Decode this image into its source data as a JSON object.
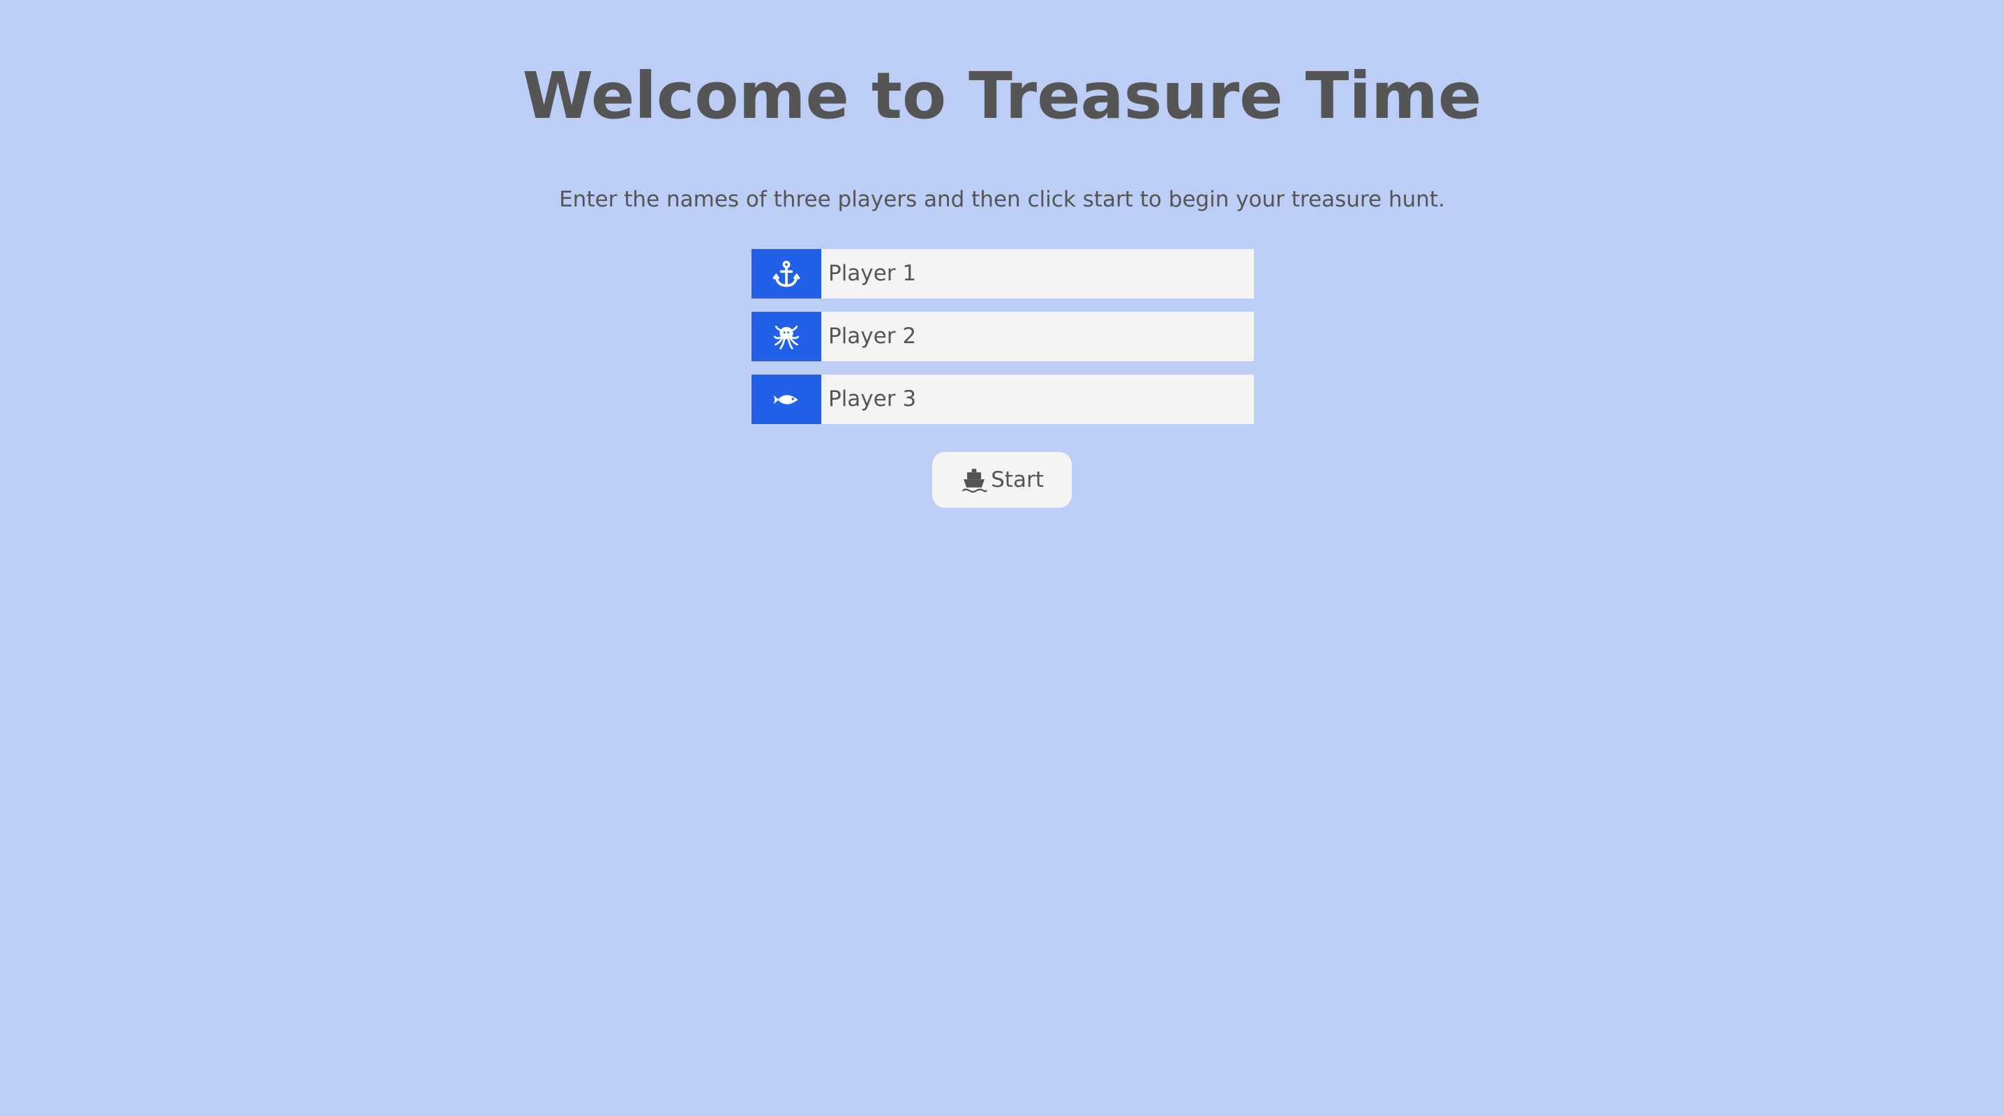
{
  "header": {
    "title": "Welcome to Treasure Time",
    "subtitle": "Enter the names of three players and then click start to begin your treasure hunt."
  },
  "players": [
    {
      "icon": "anchor-icon",
      "value": "Player 1",
      "placeholder": ""
    },
    {
      "icon": "octopus-icon",
      "value": "Player 2",
      "placeholder": ""
    },
    {
      "icon": "fish-icon",
      "value": "Player 3",
      "placeholder": ""
    }
  ],
  "start_button": {
    "icon": "ship-icon",
    "label": "Start"
  },
  "colors": {
    "background": "#bccdf6",
    "icon_background": "#2161e8",
    "input_background": "#f4f4f4",
    "text": "#555555"
  }
}
